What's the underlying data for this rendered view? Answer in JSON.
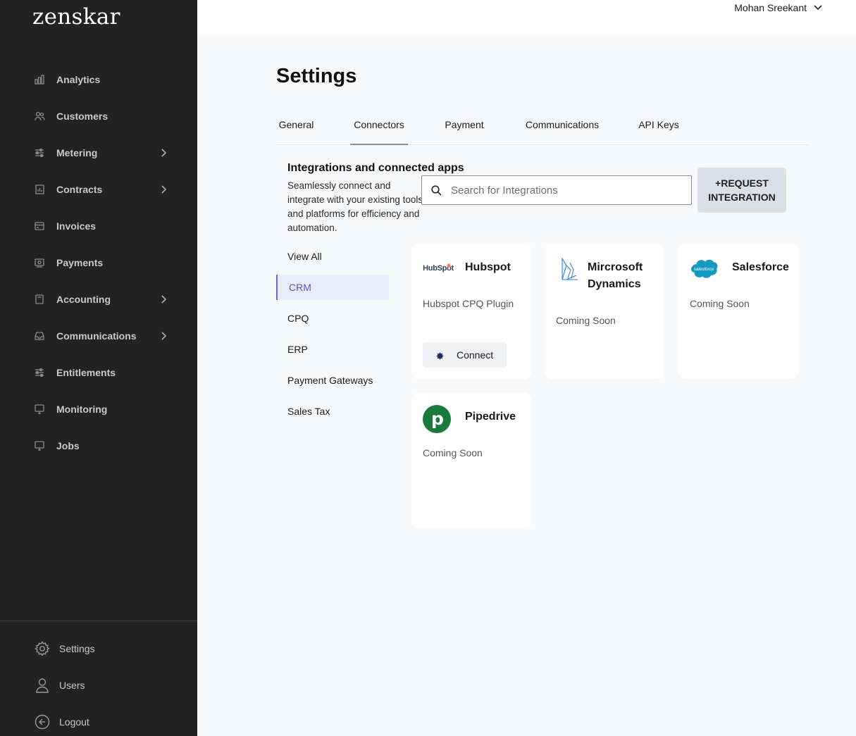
{
  "brand": {
    "logo_text": "zenskar"
  },
  "sidebar": {
    "items": [
      {
        "label": "Analytics",
        "icon": "bar-chart-icon",
        "has_chevron": false
      },
      {
        "label": "Customers",
        "icon": "users-icon",
        "has_chevron": false
      },
      {
        "label": "Metering",
        "icon": "sliders-icon",
        "has_chevron": true
      },
      {
        "label": "Contracts",
        "icon": "document-chart-icon",
        "has_chevron": true
      },
      {
        "label": "Invoices",
        "icon": "invoice-card-icon",
        "has_chevron": false
      },
      {
        "label": "Payments",
        "icon": "payment-icon",
        "has_chevron": false
      },
      {
        "label": "Accounting",
        "icon": "clipboard-icon",
        "has_chevron": true
      },
      {
        "label": "Communications",
        "icon": "inbox-icon",
        "has_chevron": true
      },
      {
        "label": "Entitlements",
        "icon": "sliders-icon",
        "has_chevron": false
      },
      {
        "label": "Monitoring",
        "icon": "monitor-icon",
        "has_chevron": false
      },
      {
        "label": "Jobs",
        "icon": "monitor-icon",
        "has_chevron": false
      }
    ],
    "bottom_items": [
      {
        "label": "Settings",
        "icon": "gear-icon"
      },
      {
        "label": "Users",
        "icon": "user-icon"
      },
      {
        "label": "Logout",
        "icon": "logout-icon"
      }
    ]
  },
  "topbar": {
    "user_name": "Mohan Sreekant"
  },
  "page": {
    "title": "Settings",
    "tabs": [
      {
        "label": "General",
        "active": false
      },
      {
        "label": "Connectors",
        "active": true
      },
      {
        "label": "Payment",
        "active": false
      },
      {
        "label": "Communications",
        "active": false
      },
      {
        "label": "API Keys",
        "active": false
      }
    ]
  },
  "integrations": {
    "title": "Integrations and connected apps",
    "description": "Seamlessly connect and integrate with your existing tools and platforms for efficiency and automation.",
    "search_placeholder": "Search for Integrations",
    "request_button": "+REQUEST\nINTEGRATION",
    "categories": [
      {
        "label": "View All",
        "active": false
      },
      {
        "label": "CRM",
        "active": true
      },
      {
        "label": "CPQ",
        "active": false
      },
      {
        "label": "ERP",
        "active": false
      },
      {
        "label": "Payment Gateways",
        "active": false
      },
      {
        "label": "Sales Tax",
        "active": false
      }
    ],
    "cards": [
      {
        "name": "Hubspot",
        "logo": "hubspot-logo",
        "logo_text": "HubSpot",
        "subtitle": "Hubspot CPQ Plugin",
        "action": "Connect"
      },
      {
        "name": "Mircrosoft Dynamics",
        "logo": "microsoft-dynamics-logo",
        "subtitle": "Coming Soon"
      },
      {
        "name": "Salesforce",
        "logo": "salesforce-logo",
        "logo_text": "salesforce",
        "subtitle": "Coming Soon"
      },
      {
        "name": "Pipedrive",
        "logo": "pipedrive-logo",
        "logo_text": "p",
        "subtitle": "Coming Soon"
      }
    ],
    "colors": {
      "hubspot_orange": "#ff7a59",
      "salesforce_blue": "#1798c1",
      "pipedrive_green": "#1a7a3c",
      "dynamics_blue": "#2a7bd6",
      "active_category": "#6b63d6"
    }
  }
}
